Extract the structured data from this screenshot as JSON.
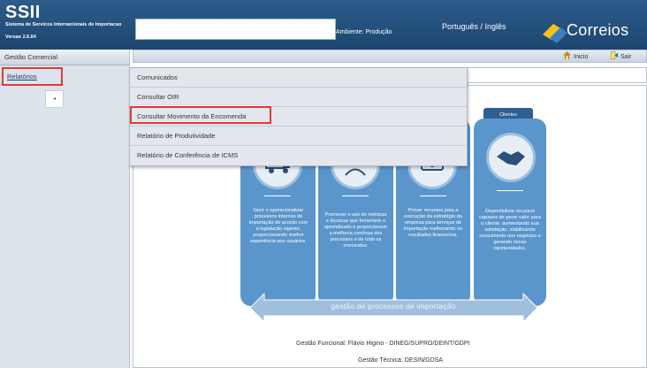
{
  "header": {
    "app_name": "SSII",
    "subtitle": "Sistema de Servicos Internacionais de Importacao",
    "version": "Versao 2.6.64",
    "environment": "Ambiente: Produção",
    "language": "Português / Inglês",
    "brand": "Correios"
  },
  "sidebar": {
    "section_title": "Gestão Comercial",
    "selected_item": "Relatórios"
  },
  "toolbar": {
    "home_label": "Inicio",
    "exit_label": "Sair"
  },
  "menu": {
    "items": [
      {
        "label": "Comunicados"
      },
      {
        "label": "Consultar OIR"
      },
      {
        "label": "Consultar Movimento da Encomenda"
      },
      {
        "label": "Relatório de Produtividade"
      },
      {
        "label": "Relatório de Conferência de ICMS"
      }
    ],
    "highlighted_index": 2
  },
  "diagram": {
    "clientes_tab": "Clientes",
    "pillars": [
      {
        "text": "Gerir e operacionalizar processos internos de importação de acordo com a legislação vigente, proporcionando melhor experiência aos usuários."
      },
      {
        "text": "Promover o uso de métricas e técnicas que fomentem o aprendizado e proporcionem a melhoria contínua dos processos e de todo os envolvidos."
      },
      {
        "text": "Prover recursos para a execução da estratégia da empresa para serviços de importação melhorando os resultados financeiros."
      },
      {
        "text": "Disponibilizar recursos capazes de gerar valor para o cliente, aumentando sua satisfação, viabilizando crescimento nos negócios e gerando novas oportunidades."
      }
    ],
    "arrow_text": "gestão de processos de importação"
  },
  "footer": {
    "functional": "Gestão Funcional: Flávio Higino - DINEG/SUPRO/DEINT/GDPI",
    "technical": "Gestão Técnica: DESIN/GDSA"
  },
  "colors": {
    "header_blue": "#1c4670",
    "pillar_blue": "#5a95cb",
    "highlight_red": "#e03a3a"
  }
}
